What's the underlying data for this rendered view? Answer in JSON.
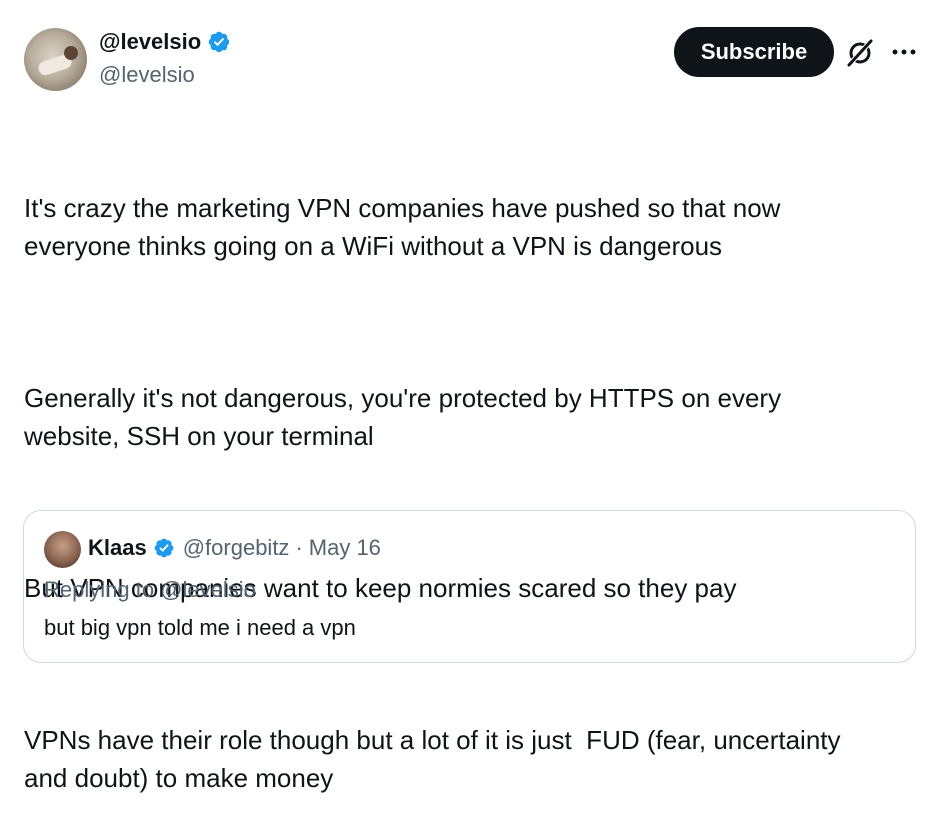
{
  "author": {
    "display_name": "@levelsio",
    "handle": "@levelsio"
  },
  "actions": {
    "subscribe_label": "Subscribe"
  },
  "tweet": {
    "paragraphs": [
      "It's crazy the marketing VPN companies have pushed so that now\neveryone thinks going on a WiFi without a VPN is dangerous",
      "Generally it's not dangerous, you're protected by HTTPS on every\nwebsite, SSH on your terminal",
      "But VPN companies want to keep normies scared so they pay",
      "VPNs have their role though but a lot of it is just  FUD (fear, uncertainty\nand doubt) to make money"
    ]
  },
  "quote": {
    "display_name": "Klaas",
    "handle": "@forgebitz",
    "separator": "·",
    "date": "May 16",
    "replying_to": "Replying to @levelsio",
    "text": "but big vpn told me i need a vpn"
  },
  "colors": {
    "text": "#0f1419",
    "secondary": "#536471",
    "verified": "#1d9bf0",
    "button_bg": "#0f1419",
    "border": "#cfd9de"
  },
  "icons": {
    "verified": "verified-badge-icon",
    "grok": "grok-icon",
    "more": "more-dots-icon"
  }
}
